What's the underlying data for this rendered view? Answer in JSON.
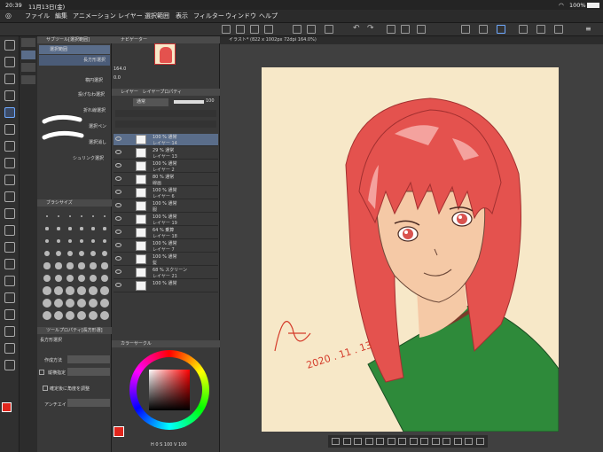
{
  "status": {
    "time": "20:39",
    "date": "11月13日(金)",
    "battery": "100%"
  },
  "menu": [
    "ファイル",
    "編集",
    "アニメーション",
    "レイヤー",
    "選択範囲",
    "表示",
    "フィルター",
    "ウィンドウ",
    "ヘルプ"
  ],
  "subtool": {
    "title": "サブツール[選択範囲]",
    "items": [
      "選択範囲",
      "長方形選択",
      "楕円選択",
      "投げなわ選択",
      "折れ線選択",
      "選択ペン",
      "選択消し",
      "シュリンク選択"
    ]
  },
  "navigator": {
    "title": "ナビゲーター",
    "zoom": "164.0",
    "angle": "0.0"
  },
  "brushsize": {
    "title": "ブラシサイズ"
  },
  "toolprop": {
    "title": "ツールプロパティ[長方形選]",
    "tool": "長方形選択",
    "mode_label": "作成方法",
    "aspect_label": "縦横指定",
    "after_label": "確定後に角度を調整",
    "aa_label": "アンチエイ"
  },
  "layers": {
    "title": "レイヤー",
    "tab2": "レイヤープロパティ",
    "blend": "通常",
    "opacity": "100",
    "rows": [
      {
        "pct": "100 % 通常",
        "name": "レイヤー 14"
      },
      {
        "pct": "29 % 通常",
        "name": "レイヤー 13"
      },
      {
        "pct": "100 % 通常",
        "name": "レイヤー 2"
      },
      {
        "pct": "80 % 通常",
        "name": "線画"
      },
      {
        "pct": "100 % 通常",
        "name": "レイヤー 6"
      },
      {
        "pct": "100 % 通常",
        "name": "服"
      },
      {
        "pct": "100 % 通常",
        "name": "レイヤー 19"
      },
      {
        "pct": "64 % 乗算",
        "name": "レイヤー 18"
      },
      {
        "pct": "100 % 通常",
        "name": "レイヤー 7"
      },
      {
        "pct": "100 % 通常",
        "name": "髪"
      },
      {
        "pct": "68 % スクリーン",
        "name": "レイヤー 21"
      },
      {
        "pct": "100 % 通常",
        "name": ""
      }
    ]
  },
  "colorcircle": {
    "title": "カラーサークル",
    "h": "H 0",
    "s": "S 100",
    "v": "V 100"
  },
  "canvas": {
    "tab": "イラスト* (822 x 1002px 72dpi 164.0%)",
    "signature_year": "2020 . 11 . 13"
  },
  "colors": {
    "hair": "#e4524e",
    "skin": "#f5c9a6",
    "uniform": "#2e8a3a",
    "paper": "#f7e8c8",
    "main": "#e0261d"
  }
}
